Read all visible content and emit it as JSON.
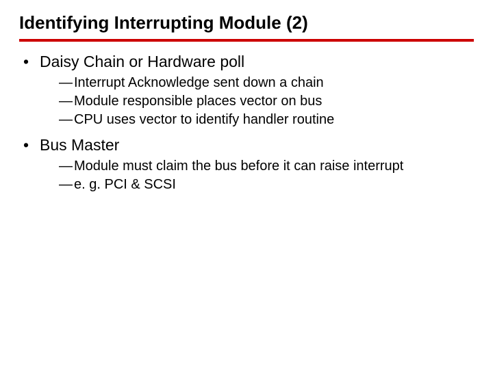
{
  "title": "Identifying Interrupting Module (2)",
  "bullets": [
    {
      "text": "Daisy Chain or Hardware poll",
      "sub": [
        "Interrupt Acknowledge sent down a chain",
        "Module responsible places vector on bus",
        "CPU uses vector to identify handler routine"
      ]
    },
    {
      "text": "Bus Master",
      "sub": [
        "Module must claim the bus before it can raise interrupt",
        "e. g. PCI & SCSI"
      ]
    }
  ]
}
